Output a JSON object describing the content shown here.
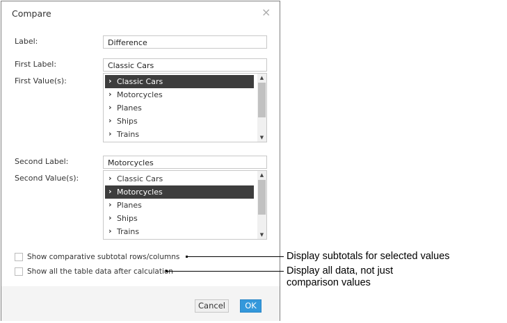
{
  "dialog": {
    "title": "Compare",
    "label_label": "Label:",
    "label_value": "Difference",
    "first_label_label": "First Label:",
    "first_label_value": "Classic Cars",
    "first_values_label": "First Value(s):",
    "first_values": [
      {
        "label": "Classic Cars",
        "selected": true
      },
      {
        "label": "Motorcycles",
        "selected": false
      },
      {
        "label": "Planes",
        "selected": false
      },
      {
        "label": "Ships",
        "selected": false
      },
      {
        "label": "Trains",
        "selected": false
      }
    ],
    "second_label_label": "Second Label:",
    "second_label_value": "Motorcycles",
    "second_values_label": "Second Value(s):",
    "second_values": [
      {
        "label": "Classic Cars",
        "selected": false
      },
      {
        "label": "Motorcycles",
        "selected": true
      },
      {
        "label": "Planes",
        "selected": false
      },
      {
        "label": "Ships",
        "selected": false
      },
      {
        "label": "Trains",
        "selected": false
      }
    ],
    "chevron": "›",
    "checkbox_subtotals": "Show comparative subtotal rows/columns",
    "checkbox_all_data": "Show all the table data after calculation",
    "cancel_label": "Cancel",
    "ok_label": "OK",
    "close_glyph": "×",
    "scroll_up_glyph": "▲",
    "scroll_down_glyph": "▼"
  },
  "callouts": {
    "subtotals": "Display subtotals for selected values",
    "all_data_line1": "Display all data, not just",
    "all_data_line2": "comparison values"
  },
  "colors": {
    "accent": "#3498db",
    "selected_row": "#3d3d3d"
  }
}
